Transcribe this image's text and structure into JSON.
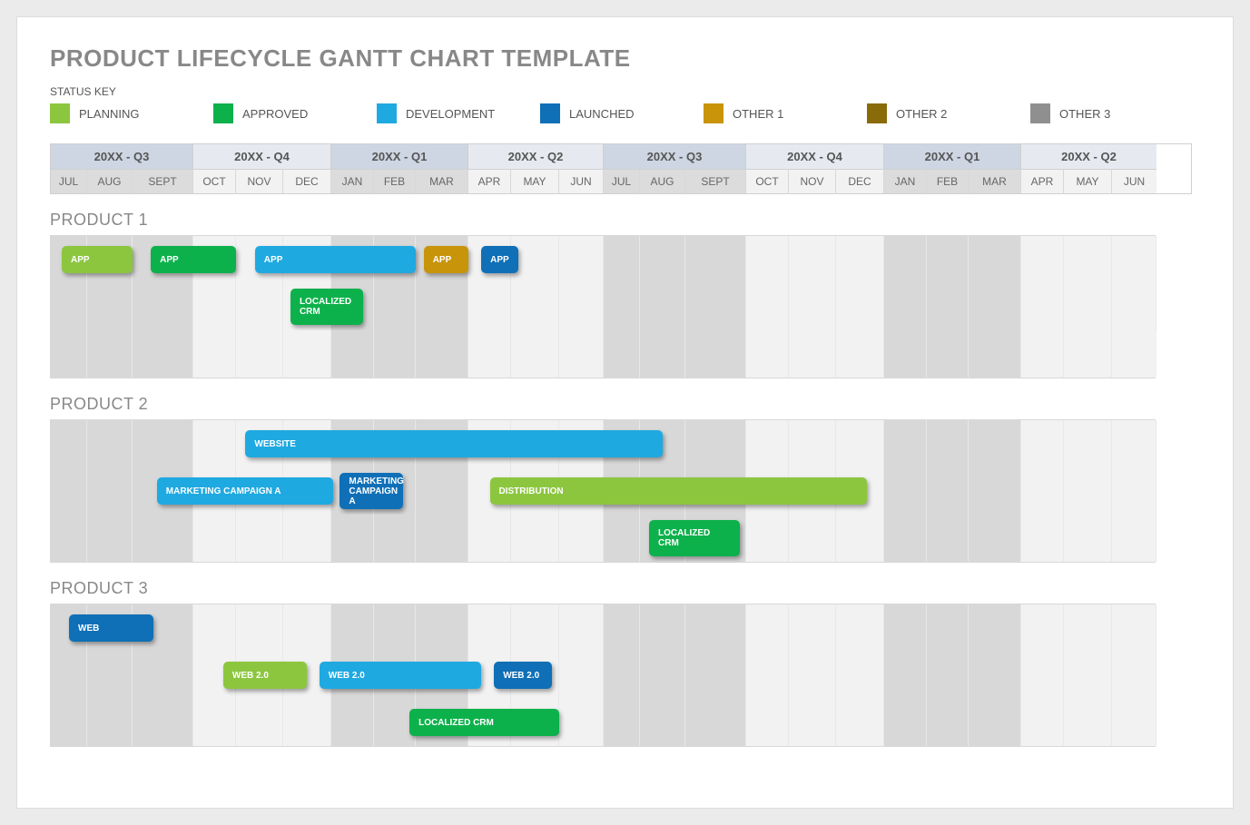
{
  "chart_data": {
    "type": "gantt",
    "time_axis": {
      "start_month_index": 0,
      "months_count": 24,
      "month_labels": [
        "JUL",
        "AUG",
        "SEPT",
        "OCT",
        "NOV",
        "DEC",
        "JAN",
        "FEB",
        "MAR",
        "APR",
        "MAY",
        "JUN",
        "JUL",
        "AUG",
        "SEPT",
        "OCT",
        "NOV",
        "DEC",
        "JAN",
        "FEB",
        "MAR",
        "APR",
        "MAY",
        "JUN"
      ]
    },
    "products": [
      {
        "name": "PRODUCT 1",
        "rows": [
          {
            "bars": [
              {
                "label": "APP",
                "status": "planning",
                "start": 0.3,
                "duration": 1.7
              },
              {
                "label": "APP",
                "status": "approved",
                "start": 2.3,
                "duration": 1.7
              },
              {
                "label": "APP",
                "status": "development",
                "start": 4.4,
                "duration": 3.6
              },
              {
                "label": "APP",
                "status": "other1",
                "start": 8.15,
                "duration": 0.85
              },
              {
                "label": "APP",
                "status": "launched",
                "start": 9.3,
                "duration": 0.85
              }
            ]
          },
          {
            "bars": [
              {
                "label": "LOCALIZED CRM",
                "status": "approved",
                "start": 5.15,
                "duration": 1.6,
                "tall": true
              }
            ]
          },
          {
            "bars": []
          }
        ]
      },
      {
        "name": "PRODUCT 2",
        "rows": [
          {
            "bars": [
              {
                "label": "WEBSITE",
                "status": "development",
                "start": 4.2,
                "duration": 9.3
              }
            ]
          },
          {
            "bars": [
              {
                "label": "MARKETING CAMPAIGN A",
                "status": "development",
                "start": 2.4,
                "duration": 3.65
              },
              {
                "label": "MARKETING CAMPAIGN A",
                "status": "launched",
                "start": 6.2,
                "duration": 1.5,
                "tall": true
              },
              {
                "label": "DISTRIBUTION",
                "status": "planning",
                "start": 9.5,
                "duration": 8.15
              }
            ]
          },
          {
            "bars": [
              {
                "label": "LOCALIZED CRM",
                "status": "approved",
                "start": 13.2,
                "duration": 1.7,
                "tall": true
              }
            ]
          }
        ]
      },
      {
        "name": "PRODUCT 3",
        "rows": [
          {
            "bars": [
              {
                "label": "WEB",
                "status": "launched",
                "start": 0.5,
                "duration": 1.85
              }
            ]
          },
          {
            "bars": [
              {
                "label": "WEB 2.0",
                "status": "planning",
                "start": 3.7,
                "duration": 1.8
              },
              {
                "label": "WEB 2.0",
                "status": "development",
                "start": 5.75,
                "duration": 3.55
              },
              {
                "label": "WEB 2.0",
                "status": "launched",
                "start": 9.6,
                "duration": 1.25
              }
            ]
          },
          {
            "bars": [
              {
                "label": "LOCALIZED CRM",
                "status": "approved",
                "start": 7.85,
                "duration": 3.15
              }
            ]
          }
        ]
      }
    ]
  },
  "title": "PRODUCT LIFECYCLE GANTT CHART TEMPLATE",
  "status_key_label": "STATUS KEY",
  "status_colors": {
    "planning": "#8cc63f",
    "approved": "#0db14b",
    "development": "#1fa9e1",
    "launched": "#0f6fb7",
    "other1": "#c8940a",
    "other2": "#8a6b0a",
    "other3": "#8f8f8f"
  },
  "legend": [
    {
      "key": "planning",
      "label": "PLANNING"
    },
    {
      "key": "approved",
      "label": "APPROVED"
    },
    {
      "key": "development",
      "label": "DEVELOPMENT"
    },
    {
      "key": "launched",
      "label": "LAUNCHED"
    },
    {
      "key": "other1",
      "label": "OTHER 1"
    },
    {
      "key": "other2",
      "label": "OTHER 2"
    },
    {
      "key": "other3",
      "label": "OTHER 3"
    }
  ],
  "quarters": [
    {
      "label": "20XX - Q3",
      "months": 3,
      "alt": false
    },
    {
      "label": "20XX - Q4",
      "months": 3,
      "alt": true
    },
    {
      "label": "20XX - Q1",
      "months": 3,
      "alt": false
    },
    {
      "label": "20XX - Q2",
      "months": 3,
      "alt": true
    },
    {
      "label": "20XX - Q3",
      "months": 3,
      "alt": false
    },
    {
      "label": "20XX - Q4",
      "months": 3,
      "alt": true
    },
    {
      "label": "20XX - Q1",
      "months": 3,
      "alt": false
    },
    {
      "label": "20XX - Q2",
      "months": 3,
      "alt": true
    }
  ],
  "month_widths": [
    40,
    50,
    67,
    47,
    52,
    53,
    47,
    46,
    58,
    47,
    53,
    49,
    40,
    50,
    67,
    47,
    52,
    53,
    47,
    46,
    58,
    47,
    53,
    49
  ]
}
